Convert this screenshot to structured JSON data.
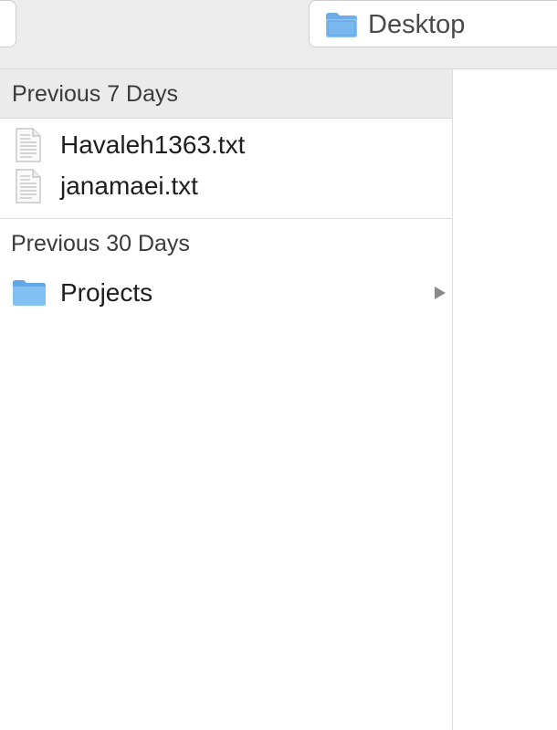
{
  "toolbar": {
    "location": {
      "label": "Desktop",
      "icon": "folder-icon"
    }
  },
  "sidebar": {
    "sections": [
      {
        "header": "Previous 7 Days",
        "items": [
          {
            "name": "Havaleh1363.txt",
            "icon": "text-document-icon"
          },
          {
            "name": "janamaei.txt",
            "icon": "text-document-icon"
          }
        ]
      },
      {
        "header": "Previous 30 Days",
        "items": [
          {
            "name": "Projects",
            "icon": "folder-icon",
            "has_children": true
          }
        ]
      }
    ]
  },
  "colors": {
    "folder_blue": "#78b8ee",
    "toolbar_bg": "#ececec",
    "header_bg": "#ebebeb"
  }
}
